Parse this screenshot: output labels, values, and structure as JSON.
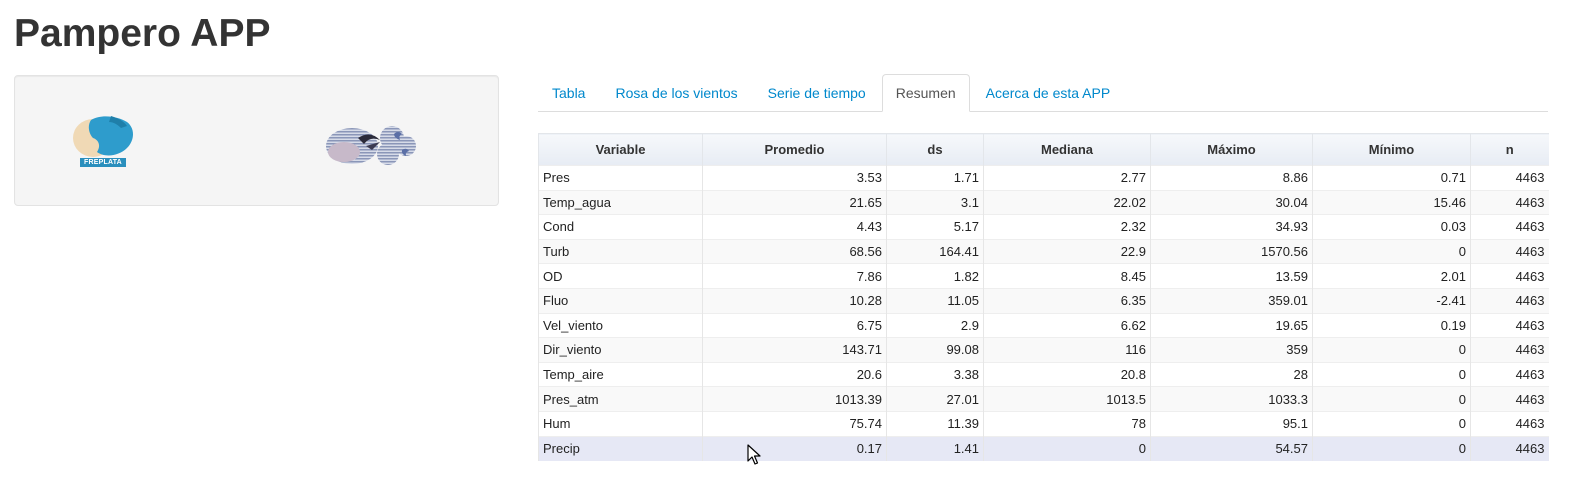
{
  "app": {
    "title": "Pampero APP"
  },
  "sidebar": {
    "logos": [
      {
        "name": "freplata-logo",
        "text": "FREPLATA"
      },
      {
        "name": "pampero-logo"
      }
    ]
  },
  "tabs": [
    {
      "label": "Tabla",
      "active": false
    },
    {
      "label": "Rosa de los vientos",
      "active": false
    },
    {
      "label": "Serie de tiempo",
      "active": false
    },
    {
      "label": "Resumen",
      "active": true
    },
    {
      "label": "Acerca de esta APP",
      "active": false
    }
  ],
  "table": {
    "columns": [
      "Variable",
      "Promedio",
      "ds",
      "Mediana",
      "Máximo",
      "Mínimo",
      "n"
    ],
    "rows": [
      [
        "Pres",
        "3.53",
        "1.71",
        "2.77",
        "8.86",
        "0.71",
        "4463"
      ],
      [
        "Temp_agua",
        "21.65",
        "3.1",
        "22.02",
        "30.04",
        "15.46",
        "4463"
      ],
      [
        "Cond",
        "4.43",
        "5.17",
        "2.32",
        "34.93",
        "0.03",
        "4463"
      ],
      [
        "Turb",
        "68.56",
        "164.41",
        "22.9",
        "1570.56",
        "0",
        "4463"
      ],
      [
        "OD",
        "7.86",
        "1.82",
        "8.45",
        "13.59",
        "2.01",
        "4463"
      ],
      [
        "Fluo",
        "10.28",
        "11.05",
        "6.35",
        "359.01",
        "-2.41",
        "4463"
      ],
      [
        "Vel_viento",
        "6.75",
        "2.9",
        "6.62",
        "19.65",
        "0.19",
        "4463"
      ],
      [
        "Dir_viento",
        "143.71",
        "99.08",
        "116",
        "359",
        "0",
        "4463"
      ],
      [
        "Temp_aire",
        "20.6",
        "3.38",
        "20.8",
        "28",
        "0",
        "4463"
      ],
      [
        "Pres_atm",
        "1013.39",
        "27.01",
        "1013.5",
        "1033.3",
        "0",
        "4463"
      ],
      [
        "Hum",
        "75.74",
        "11.39",
        "78",
        "95.1",
        "0",
        "4463"
      ],
      [
        "Precip",
        "0.17",
        "1.41",
        "0",
        "54.57",
        "0",
        "4463"
      ]
    ]
  },
  "colors": {
    "link": "#0088cc",
    "tab_active_text": "#555555",
    "header_bg": "#e7ecf4",
    "highlight_row": "#e6e8f5",
    "freplata_blue": "#2a8fbd"
  }
}
